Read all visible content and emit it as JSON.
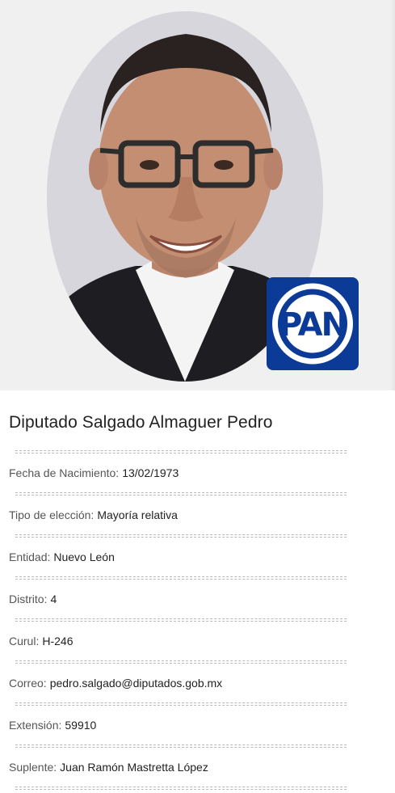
{
  "header": {
    "photo_alt": "Diputado Salgado Almaguer Pedro",
    "party_logo_text": "PAN",
    "party_color": "#0b3b97"
  },
  "profile": {
    "name": "Diputado Salgado Almaguer Pedro",
    "fields": [
      {
        "label": "Fecha de Nacimiento:",
        "value": "13/02/1973"
      },
      {
        "label": "Tipo de elección:",
        "value": "Mayoría relativa"
      },
      {
        "label": "Entidad:",
        "value": "Nuevo León"
      },
      {
        "label": "Distrito:",
        "value": "4"
      },
      {
        "label": "Curul:",
        "value": "H-246"
      },
      {
        "label": "Correo:",
        "value": "pedro.salgado@diputados.gob.mx"
      },
      {
        "label": "Extensión:",
        "value": "59910"
      },
      {
        "label": "Suplente:",
        "value": "Juan Ramón Mastretta López"
      }
    ]
  }
}
